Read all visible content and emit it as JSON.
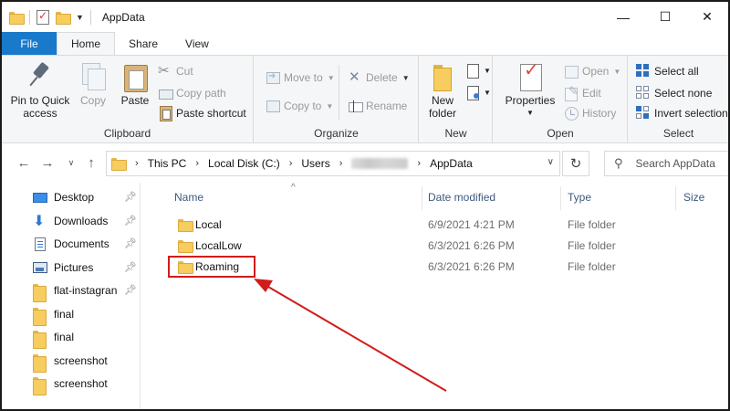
{
  "window": {
    "title": "AppData",
    "minimize_glyph": "—",
    "maximize_glyph": "☐",
    "close_glyph": "✕"
  },
  "tabs": [
    {
      "label": "File"
    },
    {
      "label": "Home"
    },
    {
      "label": "Share"
    },
    {
      "label": "View"
    }
  ],
  "ribbon": {
    "clipboard": {
      "group_label": "Clipboard",
      "pin_label_1": "Pin to Quick",
      "pin_label_2": "access",
      "copy": "Copy",
      "paste": "Paste",
      "cut": "Cut",
      "copy_path": "Copy path",
      "paste_shortcut": "Paste shortcut"
    },
    "organize": {
      "group_label": "Organize",
      "move_to": "Move to",
      "copy_to": "Copy to",
      "delete": "Delete",
      "rename": "Rename"
    },
    "new": {
      "group_label": "New",
      "new_folder_1": "New",
      "new_folder_2": "folder"
    },
    "open": {
      "group_label": "Open",
      "properties": "Properties",
      "open": "Open",
      "edit": "Edit",
      "history": "History"
    },
    "select": {
      "group_label": "Select",
      "select_all": "Select all",
      "select_none": "Select none",
      "invert_selection": "Invert selection"
    }
  },
  "address": {
    "crumbs": [
      "This PC",
      "Local Disk (C:)",
      "Users",
      "AppData"
    ],
    "search_placeholder": "Search AppData"
  },
  "sidebar": {
    "items": [
      {
        "label": "Desktop",
        "icon": "desktop-icon",
        "pinned": true
      },
      {
        "label": "Downloads",
        "icon": "download-icon",
        "pinned": true
      },
      {
        "label": "Documents",
        "icon": "documents-icon",
        "pinned": true
      },
      {
        "label": "Pictures",
        "icon": "pictures-icon",
        "pinned": true
      },
      {
        "label": "flat-instagran",
        "icon": "folder-icon",
        "pinned": true
      },
      {
        "label": "final",
        "icon": "folder-icon",
        "pinned": false
      },
      {
        "label": "final",
        "icon": "folder-icon",
        "pinned": false
      },
      {
        "label": "screenshot",
        "icon": "folder-icon",
        "pinned": false
      },
      {
        "label": "screenshot",
        "icon": "folder-icon",
        "pinned": false
      }
    ]
  },
  "file_list": {
    "columns": [
      "Name",
      "Date modified",
      "Type",
      "Size"
    ],
    "rows": [
      {
        "name": "Local",
        "date": "6/9/2021 4:21 PM",
        "type": "File folder"
      },
      {
        "name": "LocalLow",
        "date": "6/3/2021 6:26 PM",
        "type": "File folder"
      },
      {
        "name": "Roaming",
        "date": "6/3/2021 6:26 PM",
        "type": "File folder"
      }
    ]
  },
  "annotation": {
    "highlight_color": "#d11c1c",
    "highlighted_item": "Roaming"
  },
  "colors": {
    "file_tab": "#1979ca",
    "folder_yellow": "#f6cd5e",
    "accent_blue": "#2e6fc0"
  }
}
